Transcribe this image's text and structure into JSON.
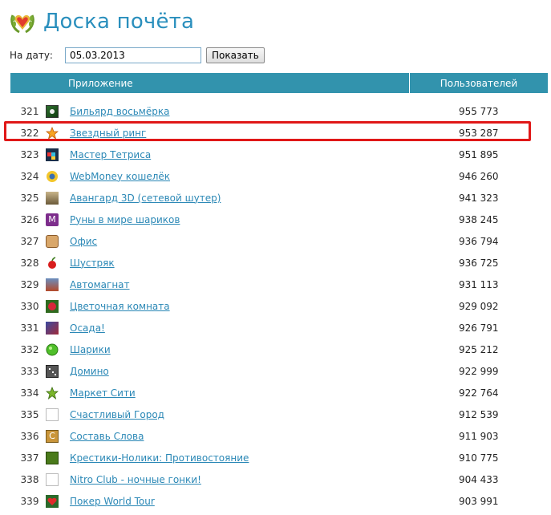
{
  "header": {
    "title": "Доска почёта",
    "logo_icon": "laurel-heart-logo"
  },
  "date_filter": {
    "label": "На дату:",
    "value": "05.03.2013",
    "button_label": "Показать"
  },
  "table": {
    "columns": {
      "app": "Приложение",
      "users": "Пользователей"
    },
    "rows": [
      {
        "rank": "321",
        "name": "Бильярд восьмёрка",
        "users": "955 773",
        "icon": "billiard-icon"
      },
      {
        "rank": "322",
        "name": "Звездный ринг",
        "users": "953 287",
        "icon": "star-icon",
        "highlighted": true
      },
      {
        "rank": "323",
        "name": "Мастер Тетриса",
        "users": "951 895",
        "icon": "tetris-icon"
      },
      {
        "rank": "324",
        "name": "WebMoney кошелёк",
        "users": "946 260",
        "icon": "webmoney-icon"
      },
      {
        "rank": "325",
        "name": "Авангард 3D (сетевой шутер)",
        "users": "941 323",
        "icon": "shooter-icon"
      },
      {
        "rank": "326",
        "name": "Руны в мире шариков",
        "users": "938 245",
        "icon": "runes-icon"
      },
      {
        "rank": "327",
        "name": "Офис",
        "users": "936 794",
        "icon": "office-icon"
      },
      {
        "rank": "328",
        "name": "Шустряк",
        "users": "936 725",
        "icon": "cherry-icon"
      },
      {
        "rank": "329",
        "name": "Автомагнат",
        "users": "931 113",
        "icon": "car-icon"
      },
      {
        "rank": "330",
        "name": "Цветочная комната",
        "users": "929 092",
        "icon": "flower-icon"
      },
      {
        "rank": "331",
        "name": "Осада!",
        "users": "926 791",
        "icon": "siege-icon"
      },
      {
        "rank": "332",
        "name": "Шарики",
        "users": "925 212",
        "icon": "ball-icon"
      },
      {
        "rank": "333",
        "name": "Домино",
        "users": "922 999",
        "icon": "domino-icon"
      },
      {
        "rank": "334",
        "name": "Маркет Сити",
        "users": "922 764",
        "icon": "market-star-icon"
      },
      {
        "rank": "335",
        "name": "Счастливый Город",
        "users": "912 539",
        "icon": "blank-icon"
      },
      {
        "rank": "336",
        "name": "Составь Слова",
        "users": "911 903",
        "icon": "words-icon"
      },
      {
        "rank": "337",
        "name": "Крестики-Нолики: Противостояние",
        "users": "910 775",
        "icon": "tictactoe-icon"
      },
      {
        "rank": "338",
        "name": "Nitro Club - ночные гонки!",
        "users": "904 433",
        "icon": "blank-icon"
      },
      {
        "rank": "339",
        "name": "Покер World Tour",
        "users": "903 991",
        "icon": "poker-heart-icon"
      }
    ]
  },
  "colors": {
    "accent": "#3293ad",
    "link": "#2b88b6",
    "title": "#2a8fbd",
    "highlight": "#e01818"
  }
}
